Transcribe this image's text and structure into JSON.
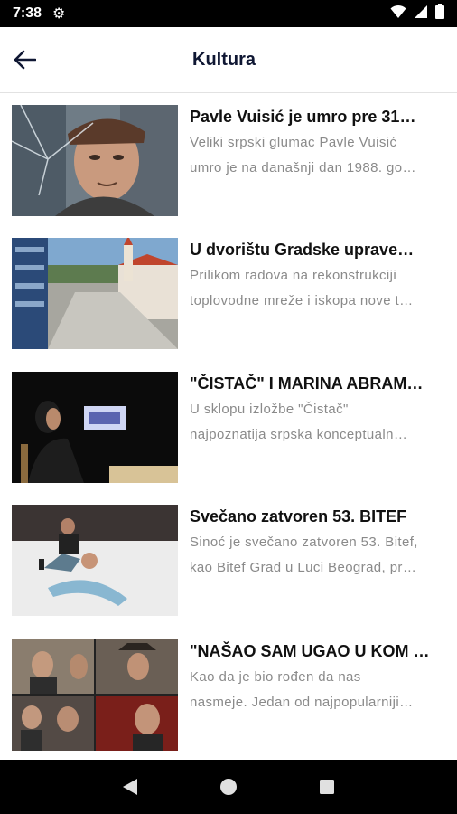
{
  "status_bar": {
    "time": "7:38",
    "icons": [
      "gear-icon",
      "wifi-icon",
      "cell-signal-icon",
      "battery-icon"
    ]
  },
  "app_bar": {
    "back_icon": "arrow-left-icon",
    "title": "Kultura"
  },
  "articles": [
    {
      "title": "Pavle Vuisić je umro pre 31…",
      "summary_line1": "Veliki srpski glumac Pavle Vuisić",
      "summary_line2": "umro je na današnji dan 1988. go…",
      "image": "portrait of an actor in a cap behind a cracked windshield"
    },
    {
      "title": "U dvorištu Gradske uprave…",
      "summary_line1": "Prilikom radova na rekonstrukciji",
      "summary_line2": "toplovodne mreže i iskopa nove t…",
      "image": "aerial view of a town square with a church"
    },
    {
      "title": "\"ČISTAČ\" I MARINA ABRAM…",
      "summary_line1": "U sklopu izložbe \"Čistač\"",
      "summary_line2": "najpoznatija srpska konceptualn…",
      "image": "woman seated in a dark room facing a small screen"
    },
    {
      "title": "Svečano zatvoren 53. BITEF",
      "summary_line1": "Sinoć je svečano zatvoren 53. Bitef,",
      "summary_line2": "kao Bitef Grad u Luci Beograd, pr…",
      "image": "two performers on a white stage"
    },
    {
      "title": "\"NAŠAO SAM UGAO U KOM …",
      "summary_line1": "Kao da je bio rođen da nas",
      "summary_line2": "nasmeje. Jedan od najpopularniji…",
      "image": "collage of four film stills"
    }
  ],
  "nav_bar": {
    "back_icon": "triangle-back-icon",
    "home_icon": "circle-home-icon",
    "recents_icon": "square-recents-icon"
  },
  "colors": {
    "title_color": "#0f1733",
    "summary_color": "#8a8a8a",
    "system_bar": "#000000"
  }
}
